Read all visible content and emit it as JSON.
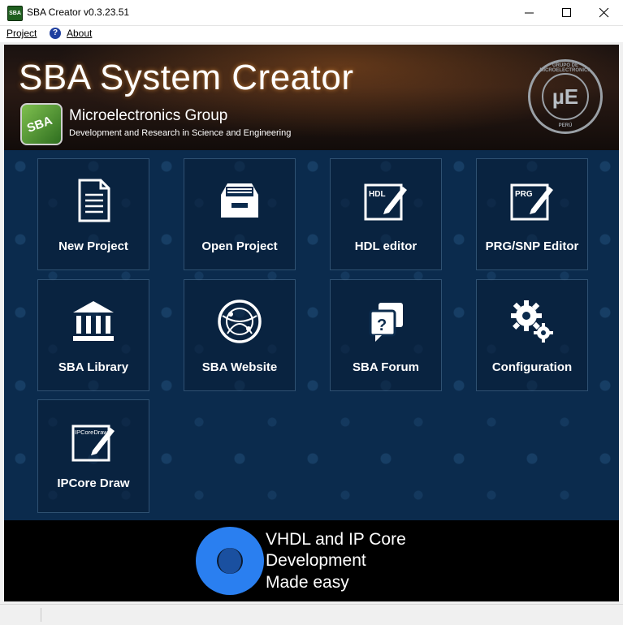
{
  "window": {
    "title": "SBA Creator v0.3.23.51",
    "icon_text": "SBA"
  },
  "menu": {
    "project": "Project",
    "about": "About"
  },
  "banner": {
    "title": "SBA System Creator",
    "logo_text": "SBA",
    "subtitle": "Microelectronics Group",
    "tagline": "Development and Research in Science and Engineering",
    "seal_top": "GRUPO DE MICROELECTRONICA",
    "seal_center": "µE",
    "seal_bottom": "PERÚ"
  },
  "tiles": [
    {
      "label": "New Project",
      "icon": "document-icon"
    },
    {
      "label": "Open Project",
      "icon": "file-drawer-icon"
    },
    {
      "label": "HDL editor",
      "icon": "hdl-edit-icon",
      "icon_text": "HDL"
    },
    {
      "label": "PRG/SNP Editor",
      "icon": "prg-edit-icon",
      "icon_text": "PRG"
    },
    {
      "label": "SBA Library",
      "icon": "library-icon"
    },
    {
      "label": "SBA Website",
      "icon": "globe-icon"
    },
    {
      "label": "SBA Forum",
      "icon": "forum-icon"
    },
    {
      "label": "Configuration",
      "icon": "gears-icon"
    },
    {
      "label": "IPCore Draw",
      "icon": "ipcore-draw-icon",
      "icon_text": "IPCoreDraw"
    }
  ],
  "footer": {
    "line1": "VHDL and IP Core",
    "line2": "Development",
    "line3": "Made easy"
  },
  "colors": {
    "content_bg": "#0b2b4d",
    "footer_ring": "#2a7ff0",
    "banner_glow": "#dc7828"
  }
}
